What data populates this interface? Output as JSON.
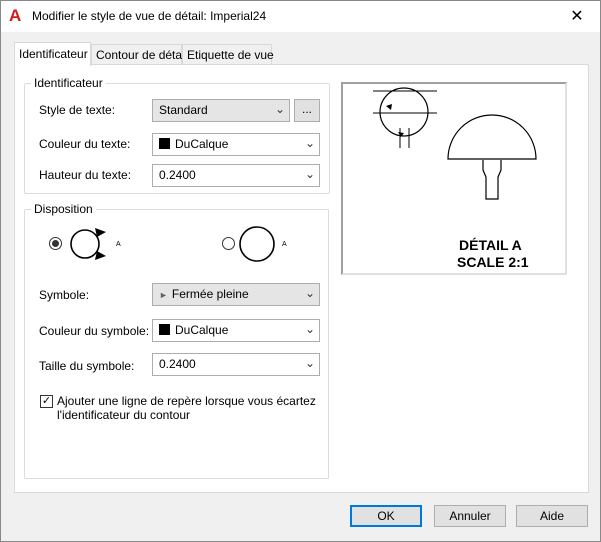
{
  "window": {
    "title": "Modifier le style de vue de détail: Imperial24",
    "app_icon": "autocad-a-icon",
    "close_glyph": "✕"
  },
  "tabs": [
    {
      "label": "Identificateur",
      "active": true
    },
    {
      "label": "Contour de détail",
      "active": false
    },
    {
      "label": "Etiquette de vue",
      "active": false
    }
  ],
  "identifier_group": {
    "title": "Identificateur",
    "text_style_label": "Style de texte:",
    "text_style_value": "Standard",
    "browse_label": "...",
    "text_color_label": "Couleur du texte:",
    "text_color_value": "DuCalque",
    "text_height_label": "Hauteur du texte:",
    "text_height_value": "0.2400"
  },
  "layout_group": {
    "title": "Disposition",
    "option_a_letter": "A",
    "option_b_letter": "A",
    "symbol_label": "Symbole:",
    "symbol_value": "Fermée pleine",
    "symbol_color_label": "Couleur du symbole:",
    "symbol_color_value": "DuCalque",
    "symbol_size_label": "Taille du symbole:",
    "symbol_size_value": "0.2400",
    "leader_checkbox_label_line1": "Ajouter une ligne de repère lorsque vous écartez",
    "leader_checkbox_label_line2": "l'identificateur du contour",
    "leader_checked": true
  },
  "preview": {
    "line1": "DÉTAIL A",
    "line2": "SCALE 2:1"
  },
  "buttons": {
    "ok": "OK",
    "cancel": "Annuler",
    "help": "Aide"
  }
}
